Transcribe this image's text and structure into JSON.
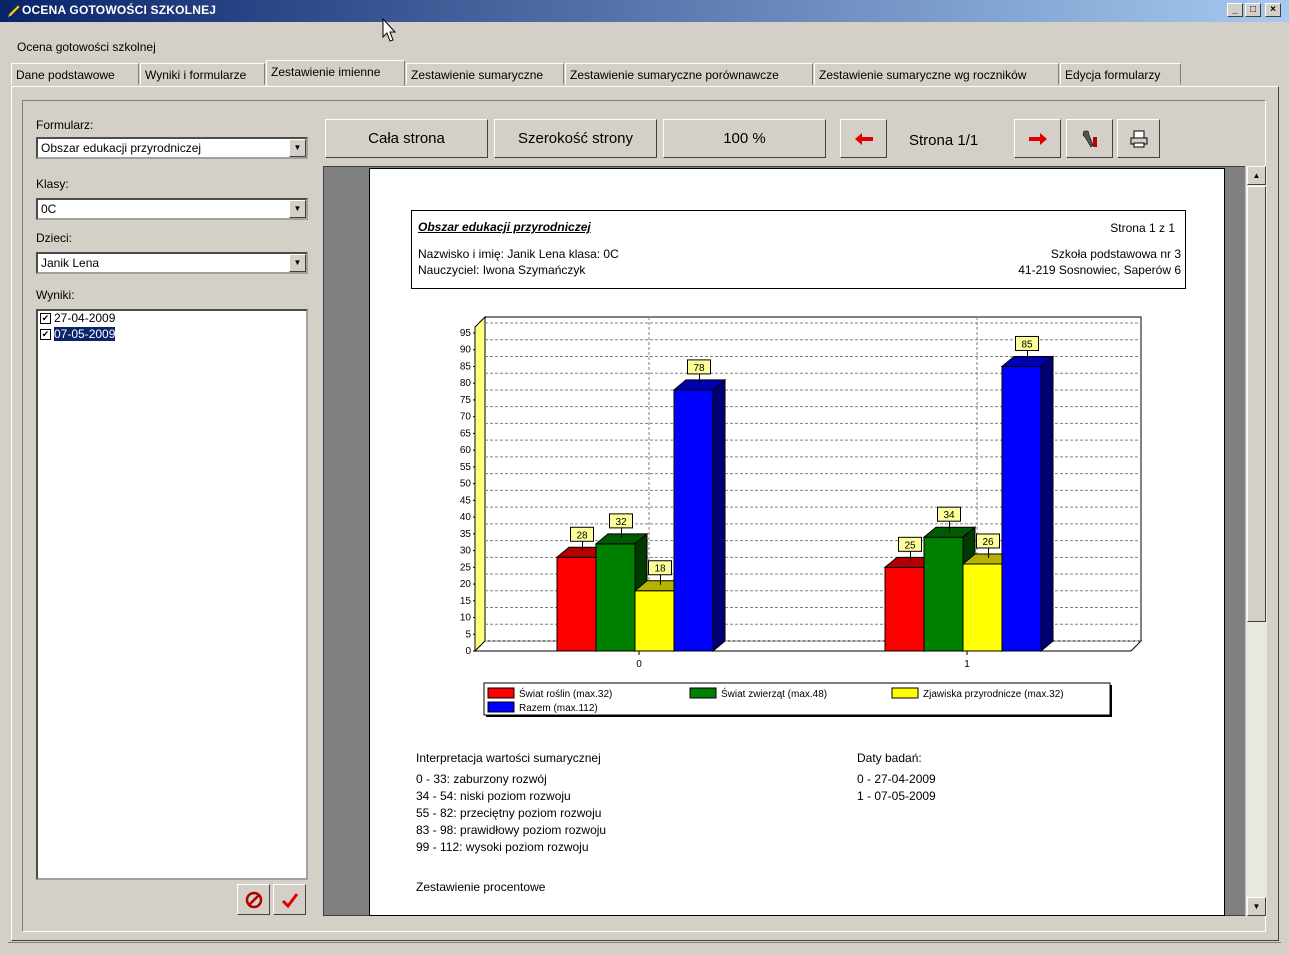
{
  "window": {
    "title": "OCENA GOTOWOŚCI SZKOLNEJ",
    "subtitle": "Ocena gotowości szkolnej",
    "min": "_",
    "max": "□",
    "close": "×"
  },
  "tabs": [
    "Dane podstawowe",
    "Wyniki i formularze",
    "Zestawienie imienne",
    "Zestawienie sumaryczne",
    "Zestawienie sumaryczne porównawcze",
    "Zestawienie sumaryczne wg roczników",
    "Edycja formularzy"
  ],
  "active_tab": "Zestawienie imienne",
  "left": {
    "formularz_label": "Formularz:",
    "formularz_value": "Obszar edukacji przyrodniczej",
    "klasy_label": "Klasy:",
    "klasy_value": "0C",
    "dzieci_label": "Dzieci:",
    "dzieci_value": "Janik Lena",
    "wyniki_label": "Wyniki:",
    "wyniki": [
      {
        "date": "27-04-2009",
        "checked": true,
        "selected": false
      },
      {
        "date": "07-05-2009",
        "checked": true,
        "selected": true
      }
    ]
  },
  "toolbar": {
    "whole_page": "Cała strona",
    "page_width": "Szerokość strony",
    "zoom": "100 %",
    "page": "Strona 1/1"
  },
  "report": {
    "title": "Obszar edukacji przyrodniczej",
    "page_info": "Strona 1 z 1",
    "name_line": "Nazwisko i imię: Janik Lena klasa: 0C",
    "teacher_line": "Nauczyciel:  Iwona Szymańczyk",
    "school": "Szkoła podstawowa nr 3",
    "address": "41-219 Sosnowiec, Saperów 6",
    "interp_title": "Interpretacja wartości sumarycznej",
    "interp": [
      "0 - 33:  zaburzony rozwój",
      "34 - 54:  niski poziom rozwoju",
      "55 - 82:  przeciętny poziom rozwoju",
      "83 - 98:  prawidłowy poziom rozwoju",
      "99 - 112:  wysoki poziom rozwoju"
    ],
    "dates_title": "Daty badań:",
    "dates": [
      "0 - 27-04-2009",
      "1 - 07-05-2009"
    ],
    "percent_title": "Zestawienie procentowe"
  },
  "chart_data": {
    "type": "bar",
    "categories": [
      "0",
      "1"
    ],
    "series": [
      {
        "name": "Świat roślin (max.32)",
        "values": [
          28,
          25
        ],
        "color": "#ff0000"
      },
      {
        "name": "Świat zwierząt (max.48)",
        "values": [
          32,
          34
        ],
        "color": "#008000"
      },
      {
        "name": "Zjawiska przyrodnicze (max.32)",
        "values": [
          18,
          26
        ],
        "color": "#ffff00"
      },
      {
        "name": "Razem (max.112)",
        "values": [
          78,
          85
        ],
        "color": "#0000ff"
      }
    ],
    "yticks": [
      0,
      5,
      10,
      15,
      20,
      25,
      30,
      35,
      40,
      45,
      50,
      55,
      60,
      65,
      70,
      75,
      80,
      85,
      90,
      95
    ],
    "ylim": [
      0,
      95
    ],
    "grid": true,
    "legend": "bottom"
  }
}
